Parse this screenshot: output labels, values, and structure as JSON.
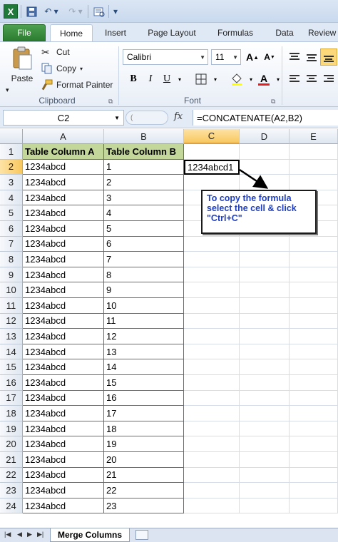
{
  "ribbon_tabs": [
    "File",
    "Home",
    "Insert",
    "Page Layout",
    "Formulas",
    "Data",
    "Review"
  ],
  "clipboard": {
    "paste_label": "Paste",
    "cut_label": "Cut",
    "copy_label": "Copy",
    "format_painter_label": "Format Painter",
    "group_label": "Clipboard"
  },
  "font": {
    "name": "Calibri",
    "size": "11",
    "group_label": "Font"
  },
  "formula_bar": {
    "name_box": "C2",
    "fx": "fx",
    "formula": "=CONCATENATE(A2,B2)"
  },
  "columns": [
    "A",
    "B",
    "C",
    "D",
    "E"
  ],
  "rows": [
    [
      "Table Column A",
      "Table Column B"
    ],
    [
      "1234abcd",
      "1"
    ],
    [
      "1234abcd",
      "2"
    ],
    [
      "1234abcd",
      "3"
    ],
    [
      "1234abcd",
      "4"
    ],
    [
      "1234abcd",
      "5"
    ],
    [
      "1234abcd",
      "6"
    ],
    [
      "1234abcd",
      "7"
    ],
    [
      "1234abcd",
      "8"
    ],
    [
      "1234abcd",
      "9"
    ],
    [
      "1234abcd",
      "10"
    ],
    [
      "1234abcd",
      "11"
    ],
    [
      "1234abcd",
      "12"
    ],
    [
      "1234abcd",
      "13"
    ],
    [
      "1234abcd",
      "14"
    ],
    [
      "1234abcd",
      "15"
    ],
    [
      "1234abcd",
      "16"
    ],
    [
      "1234abcd",
      "17"
    ],
    [
      "1234abcd",
      "18"
    ],
    [
      "1234abcd",
      "19"
    ],
    [
      "1234abcd",
      "20"
    ],
    [
      "1234abcd",
      "21"
    ],
    [
      "1234abcd",
      "22"
    ],
    [
      "1234abcd",
      "23"
    ]
  ],
  "selected_cell_value": "1234abcd1",
  "callout_text": "To copy the formula select the cell & click \"Ctrl+C\"",
  "sheet_tab": "Merge Columns",
  "colors": {
    "header_fill": "#c4d79b",
    "file_tab": "#2d7c30",
    "callout_text": "#1f3fbf",
    "selected_header": "#f8c85f"
  }
}
